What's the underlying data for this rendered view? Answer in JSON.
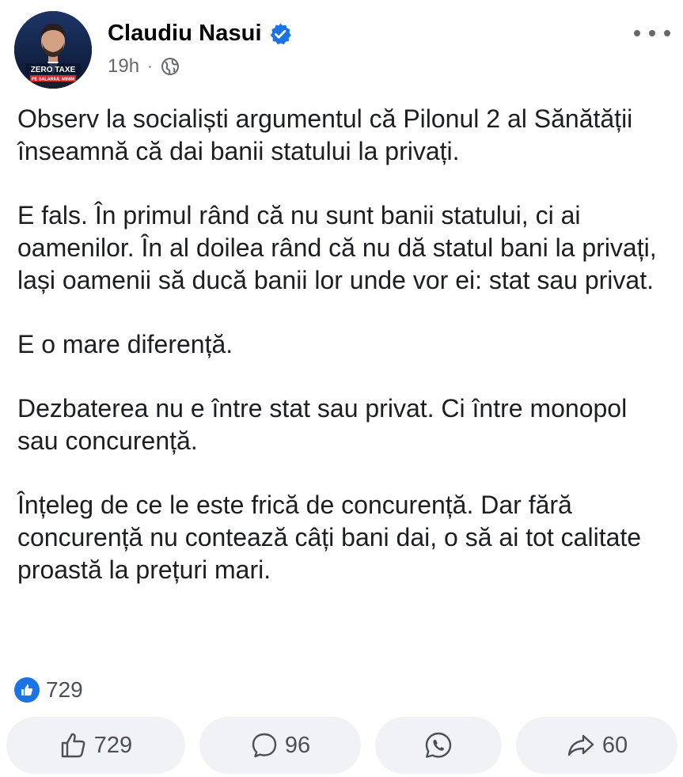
{
  "post": {
    "author": "Claudiu Nasui",
    "time": "19h",
    "separator": "·",
    "avatar_banner": {
      "line1": "ZERO TAXE",
      "line2": "PE SALARIUL MINIM"
    },
    "paragraphs": [
      "Observ la socialiști argumentul că Pilonul 2 al Sănătății înseamnă că dai banii statului la privați.",
      "E fals. În primul rând că nu sunt banii statului, ci ai oamenilor. În al doilea rând că nu dă statul bani la privați, lași oamenii să ducă banii lor unde vor ei: stat sau privat.",
      "E o mare diferență.",
      "Dezbaterea nu e între stat sau privat. Ci între monopol sau concurență.",
      "Înțeleg de ce le este frică de concurență. Dar fără concurență nu contează câți bani dai, o să ai tot calitate proastă la prețuri mari."
    ]
  },
  "reactions": {
    "total": "729"
  },
  "actions": {
    "like_count": "729",
    "comment_count": "96",
    "share_count": "60"
  },
  "icons": {
    "verified": "verified-badge-icon",
    "privacy": "globe-icon",
    "more": "more-options-icon",
    "reaction": "like-reaction-icon",
    "like": "thumbs-up-icon",
    "comment": "comment-icon",
    "whatsapp": "whatsapp-icon",
    "share": "share-arrow-icon"
  },
  "colors": {
    "accent": "#1b74e4",
    "text": "#1c1e21",
    "muted": "#65676b",
    "button_bg": "#f0f2f5"
  }
}
